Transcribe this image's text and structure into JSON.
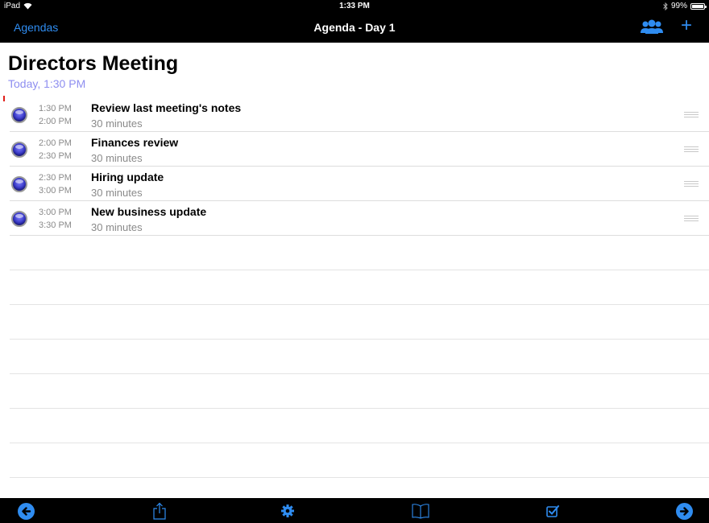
{
  "status_bar": {
    "device": "iPad",
    "time": "1:33 PM",
    "battery": "99%"
  },
  "nav": {
    "back_label": "Agendas",
    "title": "Agenda - Day 1",
    "people_icon": "people-icon",
    "add_label": "+"
  },
  "meeting": {
    "title": "Directors Meeting",
    "date": "Today, 1:30 PM"
  },
  "agenda_items": [
    {
      "start": "1:30 PM",
      "end": "2:00 PM",
      "title": "Review last meeting's notes",
      "duration": "30 minutes"
    },
    {
      "start": "2:00 PM",
      "end": "2:30 PM",
      "title": "Finances review",
      "duration": "30 minutes"
    },
    {
      "start": "2:30 PM",
      "end": "3:00 PM",
      "title": "Hiring update",
      "duration": "30 minutes"
    },
    {
      "start": "3:00 PM",
      "end": "3:30 PM",
      "title": "New business update",
      "duration": "30 minutes"
    }
  ],
  "toolbar": {
    "icons": [
      "previous-icon",
      "share-icon",
      "settings-icon",
      "book-icon",
      "checklist-icon",
      "next-icon"
    ]
  },
  "colors": {
    "accent": "#2f8cf0",
    "date_text": "#8e8ef0",
    "bar_background": "#000000"
  }
}
